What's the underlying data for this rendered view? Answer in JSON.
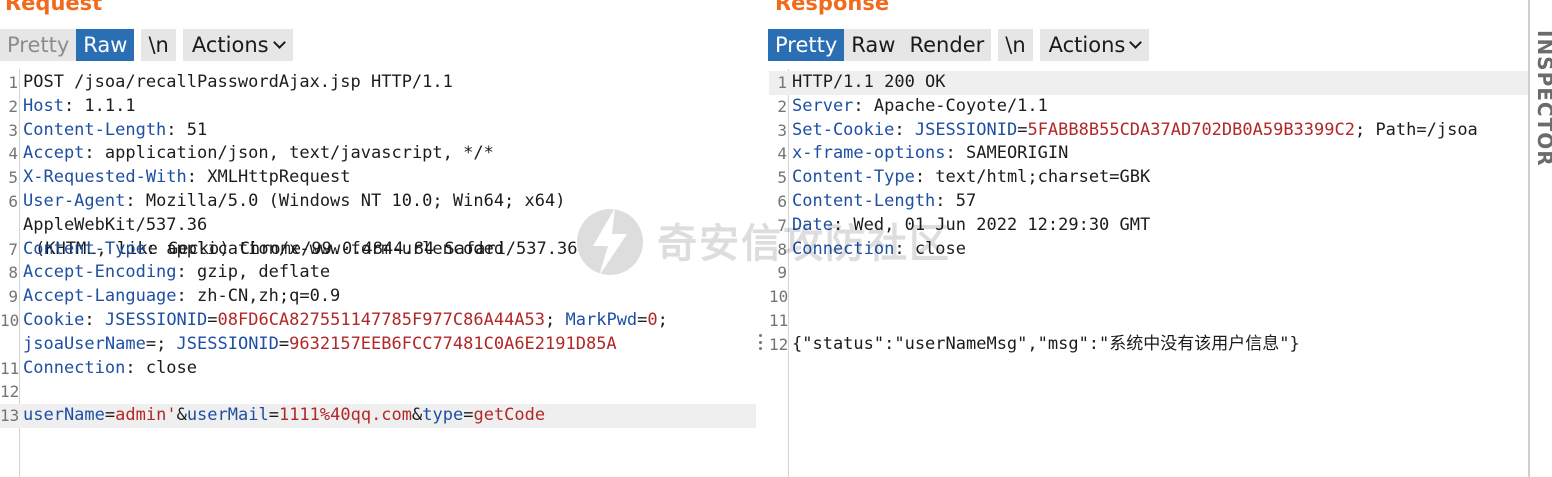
{
  "request": {
    "title": "Request",
    "toolbar": {
      "pretty": "Pretty",
      "raw": "Raw",
      "newline": "\\n",
      "actions": "Actions"
    },
    "lines": [
      {
        "n": "1",
        "parts": [
          {
            "t": "POST /jsoa/recallPasswordAjax.jsp HTTP/1.1",
            "c": "v"
          }
        ]
      },
      {
        "n": "2",
        "parts": [
          {
            "t": "Host",
            "c": "k"
          },
          {
            "t": ": 1.1.1",
            "c": "v"
          }
        ]
      },
      {
        "n": "3",
        "parts": [
          {
            "t": "Content-Length",
            "c": "k"
          },
          {
            "t": ": 51",
            "c": "v"
          }
        ]
      },
      {
        "n": "4",
        "parts": [
          {
            "t": "Accept",
            "c": "k"
          },
          {
            "t": ": application/json, text/javascript, */*",
            "c": "v"
          }
        ]
      },
      {
        "n": "5",
        "parts": [
          {
            "t": "X-Requested-With",
            "c": "k"
          },
          {
            "t": ": XMLHttpRequest",
            "c": "v"
          }
        ]
      },
      {
        "n": "6",
        "tall": true,
        "parts": [
          {
            "t": "User-Agent",
            "c": "k"
          },
          {
            "t": ": Mozilla/5.0 (Windows NT 10.0; Win64; x64) AppleWebKit/537.36",
            "c": "v"
          }
        ],
        "cont": [
          {
            "t": "(KHTML, like Gecko) Chrome/99.0.4844.84 Safari/537.36",
            "c": "v"
          }
        ]
      },
      {
        "n": "7",
        "parts": [
          {
            "t": "Content-Type",
            "c": "k"
          },
          {
            "t": ": application/x-www-form-urlencoded",
            "c": "v"
          }
        ]
      },
      {
        "n": "8",
        "parts": [
          {
            "t": "Accept-Encoding",
            "c": "k"
          },
          {
            "t": ": gzip, deflate",
            "c": "v"
          }
        ]
      },
      {
        "n": "9",
        "parts": [
          {
            "t": "Accept-Language",
            "c": "k"
          },
          {
            "t": ": zh-CN,zh;q=0.9",
            "c": "v"
          }
        ]
      },
      {
        "n": "10",
        "tall": true,
        "parts": [
          {
            "t": "Cookie",
            "c": "k"
          },
          {
            "t": ": ",
            "c": "v"
          },
          {
            "t": "JSESSIONID",
            "c": "blue"
          },
          {
            "t": "=",
            "c": "v"
          },
          {
            "t": "08FD6CA827551147785F977C86A44A53",
            "c": "red"
          },
          {
            "t": "; ",
            "c": "v"
          },
          {
            "t": "MarkPwd",
            "c": "blue"
          },
          {
            "t": "=",
            "c": "v"
          },
          {
            "t": "0",
            "c": "red"
          },
          {
            "t": ";",
            "c": "v"
          }
        ],
        "cont0": [
          {
            "t": "jsoaUserName",
            "c": "blue"
          },
          {
            "t": "=; ",
            "c": "v"
          },
          {
            "t": "JSESSIONID",
            "c": "blue"
          },
          {
            "t": "=",
            "c": "v"
          },
          {
            "t": "9632157EEB6FCC77481C0A6E2191D85A",
            "c": "red"
          }
        ]
      },
      {
        "n": "11",
        "parts": [
          {
            "t": "Connection",
            "c": "k"
          },
          {
            "t": ": close",
            "c": "v"
          }
        ]
      },
      {
        "n": "12",
        "parts": []
      },
      {
        "n": "13",
        "hl": true,
        "parts": [
          {
            "t": "userName",
            "c": "blue"
          },
          {
            "t": "=",
            "c": "v"
          },
          {
            "t": "admin'",
            "c": "red"
          },
          {
            "t": "&",
            "c": "v"
          },
          {
            "t": "userMail",
            "c": "blue"
          },
          {
            "t": "=",
            "c": "v"
          },
          {
            "t": "1111%40qq.com",
            "c": "red"
          },
          {
            "t": "&",
            "c": "v"
          },
          {
            "t": "type",
            "c": "blue"
          },
          {
            "t": "=",
            "c": "v"
          },
          {
            "t": "getCode",
            "c": "red"
          }
        ]
      }
    ]
  },
  "response": {
    "title": "Response",
    "toolbar": {
      "pretty": "Pretty",
      "raw": "Raw",
      "render": "Render",
      "newline": "\\n",
      "actions": "Actions"
    },
    "lines": [
      {
        "n": "1",
        "hl": true,
        "parts": [
          {
            "t": "HTTP/1.1 200 OK",
            "c": "v"
          }
        ]
      },
      {
        "n": "2",
        "parts": [
          {
            "t": "Server",
            "c": "k"
          },
          {
            "t": ": Apache-Coyote/1.1",
            "c": "v"
          }
        ]
      },
      {
        "n": "3",
        "parts": [
          {
            "t": "Set-Cookie",
            "c": "k"
          },
          {
            "t": ": ",
            "c": "v"
          },
          {
            "t": "JSESSIONID",
            "c": "blue"
          },
          {
            "t": "=",
            "c": "v"
          },
          {
            "t": "5FABB8B55CDA37AD702DB0A59B3399C2",
            "c": "red"
          },
          {
            "t": "; Path=/jsoa",
            "c": "v"
          }
        ]
      },
      {
        "n": "4",
        "parts": [
          {
            "t": "x-frame-options",
            "c": "k"
          },
          {
            "t": ": SAMEORIGIN",
            "c": "v"
          }
        ]
      },
      {
        "n": "5",
        "parts": [
          {
            "t": "Content-Type",
            "c": "k"
          },
          {
            "t": ": text/html;charset=GBK",
            "c": "v"
          }
        ]
      },
      {
        "n": "6",
        "parts": [
          {
            "t": "Content-Length",
            "c": "k"
          },
          {
            "t": ": 57",
            "c": "v"
          }
        ]
      },
      {
        "n": "7",
        "parts": [
          {
            "t": "Date",
            "c": "k"
          },
          {
            "t": ": Wed, 01 Jun 2022 12:29:30 GMT",
            "c": "v"
          }
        ]
      },
      {
        "n": "8",
        "parts": [
          {
            "t": "Connection",
            "c": "k"
          },
          {
            "t": ": close",
            "c": "v"
          }
        ]
      },
      {
        "n": "9",
        "parts": []
      },
      {
        "n": "10",
        "parts": []
      },
      {
        "n": "11",
        "parts": []
      },
      {
        "n": "12",
        "parts": [
          {
            "t": "{\"status\":\"userNameMsg\",\"msg\":\"系统中没有该用户信息\"}",
            "c": "v"
          }
        ]
      }
    ]
  },
  "inspector": {
    "label": "INSPECTOR"
  },
  "watermark": {
    "text": "奇安信攻防社区",
    "icon": "qianxin-logo-icon"
  },
  "colors": {
    "accent": "#f26b1d",
    "active_tab": "#2a6fb4",
    "header_key": "#1e4fa3",
    "value_red": "#b22727"
  }
}
